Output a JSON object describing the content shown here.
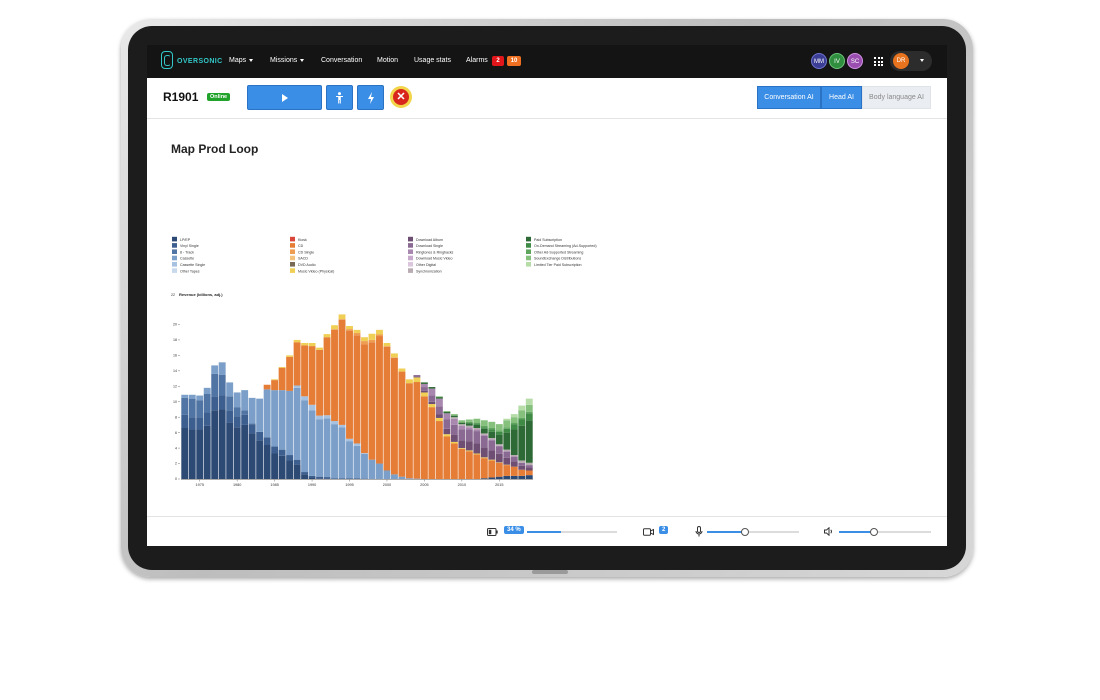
{
  "nav": {
    "logo_text": "OVERSONIC",
    "items": [
      {
        "label": "Maps",
        "dropdown": true
      },
      {
        "label": "Missions",
        "dropdown": true
      },
      {
        "label": "Conversation",
        "dropdown": false
      },
      {
        "label": "Motion",
        "dropdown": false
      },
      {
        "label": "Usage stats",
        "dropdown": false
      },
      {
        "label": "Alarms",
        "dropdown": false
      }
    ],
    "alarm_badges": [
      "2",
      "10"
    ],
    "avatars": [
      {
        "initials": "MM",
        "color": "#3b3e94"
      },
      {
        "initials": "IV",
        "color": "#2f8f3e"
      },
      {
        "initials": "SC",
        "color": "#9a4fb0"
      }
    ],
    "user_initials": "DR",
    "user_color": "#e8731e"
  },
  "toolbar": {
    "robot_id": "R1901",
    "status": "Online",
    "play_icon": "play-icon",
    "person_icon": "person-icon",
    "bolt_icon": "bolt-icon",
    "stop_icon": "close-icon",
    "ai_tabs": [
      {
        "label": "Conversation AI",
        "active": true
      },
      {
        "label": "Head AI",
        "active": true
      },
      {
        "label": "Body language AI",
        "active": false
      }
    ]
  },
  "main": {
    "title": "Map Prod Loop"
  },
  "bottom": {
    "battery_pct": "34 %",
    "camera_count": "2",
    "mic_level": 0.4,
    "volume_level": 0.37,
    "battery_level": 0.38
  },
  "chart_data": {
    "type": "bar",
    "stacked": true,
    "ylabel": "Revenue (billions, adj.)",
    "ylim": [
      0,
      22
    ],
    "yticks": [
      0,
      2,
      4,
      6,
      8,
      10,
      12,
      14,
      16,
      18,
      20,
      22
    ],
    "xticks": [
      "1975",
      "1980",
      "1985",
      "1990",
      "1995",
      "2000",
      "2005",
      "2010",
      "2015"
    ],
    "years": [
      1973,
      1974,
      1975,
      1976,
      1977,
      1978,
      1979,
      1980,
      1981,
      1982,
      1983,
      1984,
      1985,
      1986,
      1987,
      1988,
      1989,
      1990,
      1991,
      1992,
      1993,
      1994,
      1995,
      1996,
      1997,
      1998,
      1999,
      2000,
      2001,
      2002,
      2003,
      2004,
      2005,
      2006,
      2007,
      2008,
      2009,
      2010,
      2011,
      2012,
      2013,
      2014,
      2015,
      2016,
      2017,
      2018,
      2019
    ],
    "legend": [
      {
        "name": "LP/EP",
        "color": "#2d4a75"
      },
      {
        "name": "Vinyl Single",
        "color": "#3d5f8f"
      },
      {
        "name": "8 - Track",
        "color": "#5074a3"
      },
      {
        "name": "Cassette",
        "color": "#7b9fc9"
      },
      {
        "name": "Cassette Single",
        "color": "#a7c2e0"
      },
      {
        "name": "Other Tapes",
        "color": "#c8d9ec"
      },
      {
        "name": "Kiosk",
        "color": "#d9473a"
      },
      {
        "name": "CD",
        "color": "#e57d36"
      },
      {
        "name": "CD Single",
        "color": "#ee9d52"
      },
      {
        "name": "SACD",
        "color": "#f3c27c"
      },
      {
        "name": "DVD Audio",
        "color": "#7a6a55"
      },
      {
        "name": "Music Video (Physical)",
        "color": "#f0cf55"
      },
      {
        "name": "Download Album",
        "color": "#6e4f73"
      },
      {
        "name": "Download Single",
        "color": "#8a6a92"
      },
      {
        "name": "Ringtones & Ringbacks",
        "color": "#a988b0"
      },
      {
        "name": "Download Music Video",
        "color": "#c6a9cb"
      },
      {
        "name": "Other Digital",
        "color": "#dcc6de"
      },
      {
        "name": "Synchronization",
        "color": "#b9adb3"
      },
      {
        "name": "Paid Subscription",
        "color": "#2e6a35"
      },
      {
        "name": "On-Demand Streaming (Ad-Supported)",
        "color": "#3f8a45"
      },
      {
        "name": "Other Ad-Supported Streaming",
        "color": "#5fa55e"
      },
      {
        "name": "SoundExchange Distributions",
        "color": "#86c07d"
      },
      {
        "name": "Limited Tier Paid Subscription",
        "color": "#b6dca8"
      }
    ],
    "series": [
      {
        "name": "LP/EP",
        "values": [
          6.6,
          6.4,
          6.4,
          6.9,
          8.9,
          9.0,
          7.3,
          6.7,
          7.0,
          5.9,
          5.0,
          4.4,
          3.3,
          3.0,
          2.4,
          1.9,
          0.6,
          0.2,
          0.1,
          0.05,
          0,
          0,
          0,
          0,
          0,
          0,
          0,
          0,
          0,
          0,
          0,
          0,
          0,
          0,
          0,
          0,
          0,
          0,
          0,
          0,
          0.1,
          0.2,
          0.3,
          0.4,
          0.4,
          0.4,
          0.5
        ]
      },
      {
        "name": "Vinyl Single",
        "values": [
          1.7,
          1.6,
          1.6,
          1.7,
          1.8,
          1.8,
          1.6,
          1.4,
          1.3,
          1.2,
          1.1,
          1.0,
          0.9,
          0.8,
          0.7,
          0.6,
          0.3,
          0.2,
          0.2,
          0.2,
          0.1,
          0.1,
          0.1,
          0.1,
          0.05,
          0,
          0,
          0,
          0,
          0,
          0,
          0,
          0,
          0,
          0,
          0,
          0,
          0,
          0,
          0,
          0,
          0,
          0,
          0,
          0,
          0,
          0
        ]
      },
      {
        "name": "8 - Track",
        "values": [
          2.2,
          2.4,
          2.2,
          2.4,
          2.9,
          2.7,
          1.8,
          1.2,
          0.6,
          0.1,
          0,
          0,
          0,
          0,
          0,
          0,
          0,
          0,
          0,
          0,
          0,
          0,
          0,
          0,
          0,
          0,
          0,
          0,
          0,
          0,
          0,
          0,
          0,
          0,
          0,
          0,
          0,
          0,
          0,
          0,
          0,
          0,
          0,
          0,
          0,
          0,
          0
        ]
      },
      {
        "name": "Cassette",
        "values": [
          0.4,
          0.5,
          0.6,
          0.8,
          1.1,
          1.6,
          1.8,
          1.9,
          2.6,
          3.3,
          4.3,
          6.2,
          7.3,
          7.7,
          8.3,
          9.3,
          9.3,
          8.5,
          7.4,
          7.6,
          7.0,
          6.6,
          4.8,
          4.2,
          3.2,
          2.5,
          2.0,
          1.1,
          0.6,
          0.3,
          0.1,
          0.05,
          0,
          0,
          0,
          0,
          0,
          0,
          0,
          0,
          0,
          0,
          0,
          0,
          0,
          0,
          0
        ]
      },
      {
        "name": "Cassette Single",
        "values": [
          0,
          0,
          0,
          0,
          0,
          0,
          0,
          0,
          0,
          0,
          0,
          0,
          0,
          0,
          0,
          0.3,
          0.5,
          0.7,
          0.5,
          0.4,
          0.4,
          0.3,
          0.3,
          0.3,
          0.1,
          0,
          0,
          0,
          0,
          0,
          0,
          0,
          0,
          0,
          0,
          0,
          0,
          0,
          0,
          0,
          0,
          0,
          0,
          0,
          0,
          0,
          0
        ]
      },
      {
        "name": "CD",
        "values": [
          0,
          0,
          0,
          0,
          0,
          0,
          0,
          0,
          0,
          0,
          0,
          0.6,
          1.3,
          2.9,
          4.4,
          5.6,
          6.6,
          7.6,
          8.5,
          10.1,
          11.8,
          13.6,
          14.0,
          14.0,
          14.1,
          15.2,
          16.5,
          16.0,
          15.1,
          13.6,
          12.3,
          12.5,
          10.7,
          9.3,
          7.5,
          5.5,
          4.6,
          3.9,
          3.6,
          3.2,
          2.6,
          2.2,
          1.8,
          1.4,
          1.2,
          0.8,
          0.6
        ]
      },
      {
        "name": "CD Single",
        "values": [
          0,
          0,
          0,
          0,
          0,
          0,
          0,
          0,
          0,
          0,
          0,
          0,
          0,
          0,
          0,
          0,
          0,
          0,
          0,
          0,
          0.1,
          0.1,
          0.2,
          0.3,
          0.4,
          0.3,
          0.2,
          0.1,
          0.05,
          0,
          0,
          0,
          0,
          0,
          0,
          0,
          0,
          0,
          0,
          0,
          0,
          0,
          0,
          0,
          0,
          0,
          0
        ]
      },
      {
        "name": "Music Video (Physical)",
        "values": [
          0,
          0,
          0,
          0,
          0,
          0,
          0,
          0,
          0,
          0,
          0,
          0,
          0.1,
          0.1,
          0.2,
          0.3,
          0.3,
          0.4,
          0.3,
          0.4,
          0.5,
          0.6,
          0.4,
          0.4,
          0.5,
          0.8,
          0.6,
          0.4,
          0.5,
          0.4,
          0.5,
          0.6,
          0.5,
          0.4,
          0.4,
          0.3,
          0.2,
          0.1,
          0.1,
          0.1,
          0.1,
          0.1,
          0.05,
          0.05,
          0,
          0,
          0
        ]
      },
      {
        "name": "Download Album",
        "values": [
          0,
          0,
          0,
          0,
          0,
          0,
          0,
          0,
          0,
          0,
          0,
          0,
          0,
          0,
          0,
          0,
          0,
          0,
          0,
          0,
          0,
          0,
          0,
          0,
          0,
          0,
          0,
          0,
          0,
          0,
          0,
          0.1,
          0.2,
          0.3,
          0.5,
          0.7,
          0.9,
          1.0,
          1.2,
          1.3,
          1.3,
          1.2,
          1.1,
          0.9,
          0.7,
          0.5,
          0.4
        ]
      },
      {
        "name": "Download Single",
        "values": [
          0,
          0,
          0,
          0,
          0,
          0,
          0,
          0,
          0,
          0,
          0,
          0,
          0,
          0,
          0,
          0,
          0,
          0,
          0,
          0,
          0,
          0,
          0,
          0,
          0,
          0,
          0,
          0,
          0,
          0,
          0,
          0.2,
          0.5,
          0.8,
          1.0,
          1.2,
          1.3,
          1.4,
          1.5,
          1.6,
          1.5,
          1.3,
          1.0,
          0.8,
          0.6,
          0.4,
          0.3
        ]
      },
      {
        "name": "Ringtones & Ringbacks",
        "values": [
          0,
          0,
          0,
          0,
          0,
          0,
          0,
          0,
          0,
          0,
          0,
          0,
          0,
          0,
          0,
          0,
          0,
          0,
          0,
          0,
          0,
          0,
          0,
          0,
          0,
          0,
          0,
          0,
          0,
          0,
          0,
          0,
          0.4,
          0.9,
          1.0,
          0.8,
          0.8,
          0.5,
          0.3,
          0.2,
          0.1,
          0.1,
          0.05,
          0.05,
          0,
          0,
          0
        ]
      },
      {
        "name": "Synchronization",
        "values": [
          0,
          0,
          0,
          0,
          0,
          0,
          0,
          0,
          0,
          0,
          0,
          0,
          0,
          0,
          0,
          0,
          0,
          0,
          0,
          0,
          0,
          0,
          0,
          0,
          0,
          0,
          0,
          0,
          0,
          0,
          0,
          0,
          0,
          0,
          0,
          0,
          0.2,
          0.2,
          0.2,
          0.2,
          0.2,
          0.2,
          0.2,
          0.2,
          0.2,
          0.3,
          0.3
        ]
      },
      {
        "name": "Paid Subscription",
        "values": [
          0,
          0,
          0,
          0,
          0,
          0,
          0,
          0,
          0,
          0,
          0,
          0,
          0,
          0,
          0,
          0,
          0,
          0,
          0,
          0,
          0,
          0,
          0,
          0,
          0,
          0,
          0,
          0,
          0,
          0,
          0,
          0,
          0.2,
          0.2,
          0.2,
          0.2,
          0.2,
          0.2,
          0.3,
          0.4,
          0.6,
          0.8,
          1.2,
          2.2,
          3.3,
          4.5,
          5.5
        ]
      },
      {
        "name": "On-Demand Streaming (Ad-Supported)",
        "values": [
          0,
          0,
          0,
          0,
          0,
          0,
          0,
          0,
          0,
          0,
          0,
          0,
          0,
          0,
          0,
          0,
          0,
          0,
          0,
          0,
          0,
          0,
          0,
          0,
          0,
          0,
          0,
          0,
          0,
          0,
          0,
          0,
          0,
          0,
          0,
          0,
          0,
          0,
          0.1,
          0.2,
          0.2,
          0.3,
          0.4,
          0.5,
          0.7,
          0.8,
          0.9
        ]
      },
      {
        "name": "Other Ad-Supported Streaming",
        "values": [
          0,
          0,
          0,
          0,
          0,
          0,
          0,
          0,
          0,
          0,
          0,
          0,
          0,
          0,
          0,
          0,
          0,
          0,
          0,
          0,
          0,
          0,
          0,
          0,
          0,
          0,
          0,
          0,
          0,
          0,
          0,
          0,
          0,
          0,
          0,
          0,
          0,
          0,
          0.1,
          0.1,
          0.2,
          0.2,
          0.2,
          0.2,
          0.2,
          0.2,
          0.2
        ]
      },
      {
        "name": "SoundExchange Distributions",
        "values": [
          0,
          0,
          0,
          0,
          0,
          0,
          0,
          0,
          0,
          0,
          0,
          0,
          0,
          0,
          0,
          0,
          0,
          0,
          0,
          0,
          0,
          0,
          0,
          0,
          0,
          0,
          0,
          0,
          0,
          0,
          0,
          0,
          0,
          0,
          0.1,
          0.1,
          0.2,
          0.3,
          0.3,
          0.5,
          0.7,
          0.8,
          0.8,
          0.9,
          0.7,
          1.0,
          0.9
        ]
      },
      {
        "name": "Limited Tier Paid Subscription",
        "values": [
          0,
          0,
          0,
          0,
          0,
          0,
          0,
          0,
          0,
          0,
          0,
          0,
          0,
          0,
          0,
          0,
          0,
          0,
          0,
          0,
          0,
          0,
          0,
          0,
          0,
          0,
          0,
          0,
          0,
          0,
          0,
          0,
          0,
          0,
          0,
          0,
          0,
          0,
          0,
          0,
          0,
          0,
          0,
          0.2,
          0.4,
          0.6,
          0.8
        ]
      }
    ]
  }
}
